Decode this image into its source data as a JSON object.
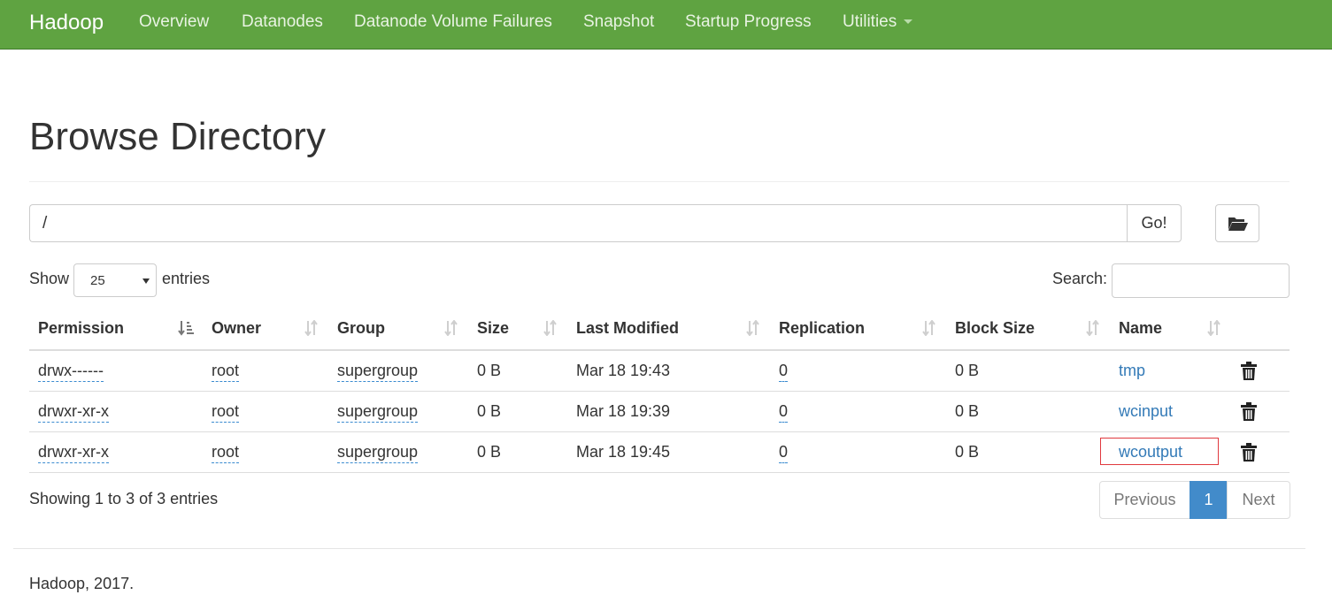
{
  "navbar": {
    "brand": "Hadoop",
    "items": [
      "Overview",
      "Datanodes",
      "Datanode Volume Failures",
      "Snapshot",
      "Startup Progress",
      "Utilities"
    ],
    "accent": "#5fa341"
  },
  "page": {
    "title": "Browse Directory"
  },
  "path": {
    "value": "/",
    "go_label": "Go!",
    "folder_icon": "folder-open-icon"
  },
  "length": {
    "show_label": "Show",
    "value": "25",
    "entries_label": "entries"
  },
  "search": {
    "label": "Search:",
    "value": ""
  },
  "table": {
    "headers": [
      "Permission",
      "Owner",
      "Group",
      "Size",
      "Last Modified",
      "Replication",
      "Block Size",
      "Name"
    ],
    "rows": [
      {
        "permission": "drwx------",
        "owner": "root",
        "group": "supergroup",
        "size": "0 B",
        "modified": "Mar 18 19:43",
        "replication": "0",
        "block_size": "0 B",
        "name": "tmp"
      },
      {
        "permission": "drwxr-xr-x",
        "owner": "root",
        "group": "supergroup",
        "size": "0 B",
        "modified": "Mar 18 19:39",
        "replication": "0",
        "block_size": "0 B",
        "name": "wcinput"
      },
      {
        "permission": "drwxr-xr-x",
        "owner": "root",
        "group": "supergroup",
        "size": "0 B",
        "modified": "Mar 18 19:45",
        "replication": "0",
        "block_size": "0 B",
        "name": "wcoutput"
      }
    ]
  },
  "info": "Showing 1 to 3 of 3 entries",
  "pagination": {
    "previous": "Previous",
    "current": "1",
    "next": "Next"
  },
  "footer": "Hadoop, 2017."
}
